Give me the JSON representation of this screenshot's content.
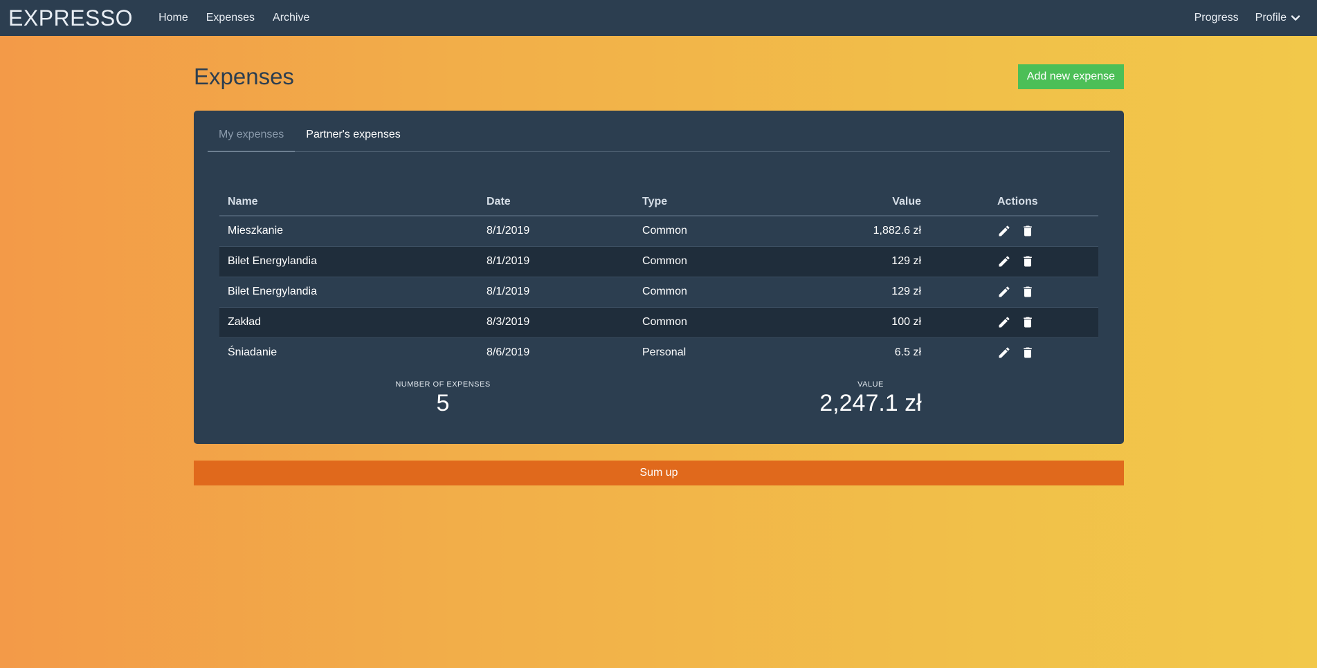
{
  "navbar": {
    "brand": "EXPRESSO",
    "links": [
      "Home",
      "Expenses",
      "Archive"
    ],
    "right": {
      "progress": "Progress",
      "profile": "Profile"
    }
  },
  "page": {
    "title": "Expenses",
    "add_button": "Add new expense"
  },
  "tabs": [
    "My expenses",
    "Partner's expenses"
  ],
  "table": {
    "headers": [
      "Name",
      "Date",
      "Type",
      "Value",
      "Actions"
    ],
    "rows": [
      {
        "name": "Mieszkanie",
        "date": "8/1/2019",
        "type": "Common",
        "value": "1,882.6 zł"
      },
      {
        "name": "Bilet Energylandia",
        "date": "8/1/2019",
        "type": "Common",
        "value": "129 zł"
      },
      {
        "name": "Bilet Energylandia",
        "date": "8/1/2019",
        "type": "Common",
        "value": "129 zł"
      },
      {
        "name": "Zakład",
        "date": "8/3/2019",
        "type": "Common",
        "value": "100 zł"
      },
      {
        "name": "Śniadanie",
        "date": "8/6/2019",
        "type": "Personal",
        "value": "6.5 zł"
      }
    ]
  },
  "stats": {
    "count_label": "NUMBER OF EXPENSES",
    "count_value": "5",
    "value_label": "VALUE",
    "value_value": "2,247.1 zł"
  },
  "sumup_label": "Sum up",
  "colors": {
    "navbar": "#2c3e50",
    "card": "#2c3e50",
    "add_button": "#4cbf57",
    "sumup_button": "#e0691c"
  },
  "icons": [
    "chevron-down-icon",
    "pencil-icon",
    "trash-icon"
  ]
}
